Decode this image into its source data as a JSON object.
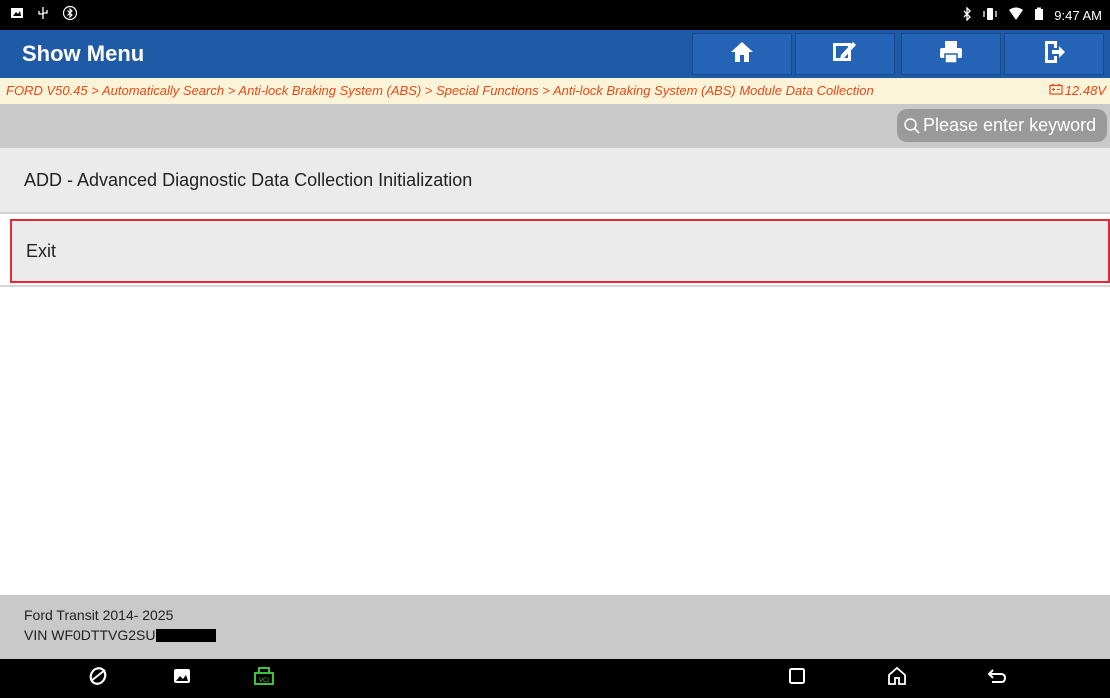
{
  "status_bar": {
    "time": "9:47 AM",
    "left_icons": [
      "gallery-notification-icon",
      "usb-icon",
      "bluetooth-settings-icon"
    ],
    "right_icons": [
      "bluetooth-icon",
      "vibrate-icon",
      "wifi-icon",
      "battery-icon"
    ]
  },
  "header": {
    "title": "Show Menu",
    "buttons": [
      "home-button",
      "edit-report-button",
      "print-button",
      "exit-button"
    ]
  },
  "breadcrumb": {
    "path": "FORD V50.45 > Automatically Search > Anti-lock Braking System (ABS) > Special Functions > Anti-lock Braking System (ABS) Module Data Collection",
    "voltage": "12.48V"
  },
  "search": {
    "placeholder": "Please enter keyword"
  },
  "menu": {
    "items": [
      {
        "label": "ADD - Advanced Diagnostic Data Collection Initialization"
      },
      {
        "label": "Exit",
        "selected": true
      }
    ]
  },
  "vehicle": {
    "name": "Ford Transit 2014- 2025",
    "vin_prefix": "VIN WF0DTTVG2SU"
  },
  "colors": {
    "title_bar": "#1f5aa6",
    "breadcrumb_text": "#e64a19",
    "selection_border": "#e22a33",
    "vci_icon": "#3fbf3f"
  }
}
